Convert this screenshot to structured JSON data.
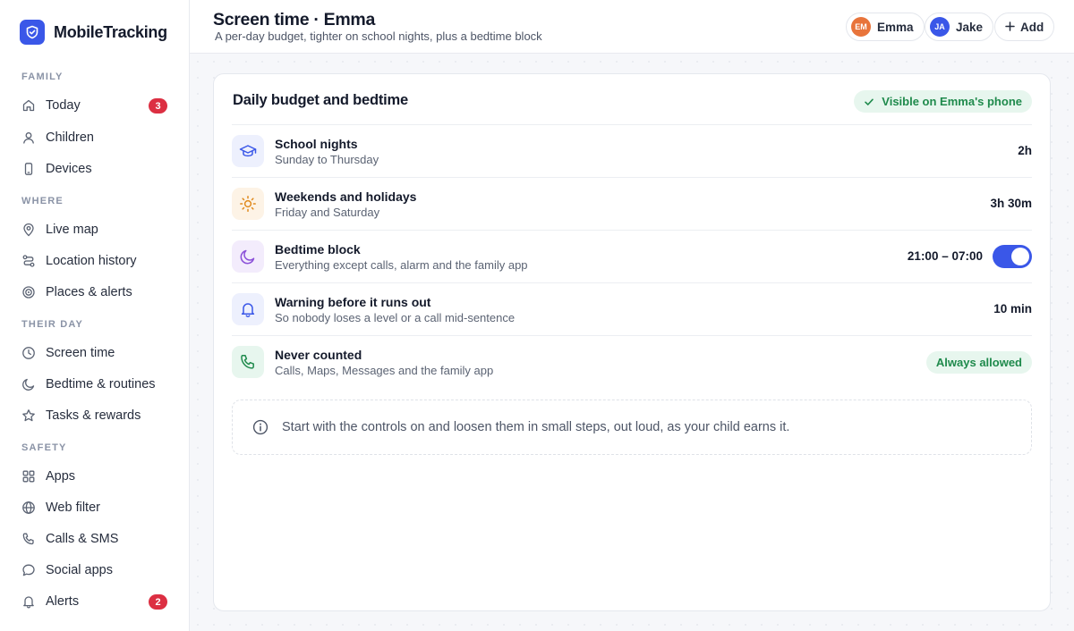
{
  "app": {
    "name": "MobileTracking"
  },
  "sidebar": {
    "sections": [
      {
        "label": "FAMILY",
        "items": [
          {
            "label": "Today",
            "icon": "home-icon",
            "badge": "3"
          },
          {
            "label": "Children",
            "icon": "person-icon"
          },
          {
            "label": "Devices",
            "icon": "phone-icon"
          }
        ]
      },
      {
        "label": "WHERE",
        "items": [
          {
            "label": "Live map",
            "icon": "pin-icon"
          },
          {
            "label": "Location history",
            "icon": "route-icon"
          },
          {
            "label": "Places & alerts",
            "icon": "target-icon"
          }
        ]
      },
      {
        "label": "THEIR DAY",
        "items": [
          {
            "label": "Screen time",
            "icon": "clock-icon"
          },
          {
            "label": "Bedtime & routines",
            "icon": "moon-icon"
          },
          {
            "label": "Tasks & rewards",
            "icon": "star-icon"
          }
        ]
      },
      {
        "label": "SAFETY",
        "items": [
          {
            "label": "Apps",
            "icon": "grid-icon"
          },
          {
            "label": "Web filter",
            "icon": "globe-icon"
          },
          {
            "label": "Calls & SMS",
            "icon": "phone-call-icon"
          },
          {
            "label": "Social apps",
            "icon": "chat-icon"
          },
          {
            "label": "Alerts",
            "icon": "bell-icon",
            "badge": "2"
          }
        ]
      }
    ]
  },
  "header": {
    "title": "Screen time · Emma",
    "subtitle": "A per-day budget, tighter on school nights, plus a bedtime block",
    "children": [
      {
        "initials": "EM",
        "name": "Emma",
        "color": "#e8743b"
      },
      {
        "initials": "JA",
        "name": "Jake",
        "color": "#3a57e8"
      }
    ],
    "add_label": "Add"
  },
  "card": {
    "title": "Daily budget and bedtime",
    "visibility": "Visible on Emma's phone",
    "rows": [
      {
        "title": "School nights",
        "subtitle": "Sunday to Thursday",
        "value": "2h",
        "icon": "graduation-cap-icon",
        "color": "#3a57e8"
      },
      {
        "title": "Weekends and holidays",
        "subtitle": "Friday and Saturday",
        "value": "3h 30m",
        "icon": "sun-icon",
        "color": "#e08a1e"
      },
      {
        "title": "Bedtime block",
        "subtitle": "Everything except calls, alarm and the family app",
        "value": "21:00 – 07:00",
        "icon": "moon-icon",
        "color": "#8a4fd8",
        "toggle_on": true
      },
      {
        "title": "Warning before it runs out",
        "subtitle": "So nobody loses a level or a call mid-sentence",
        "value": "10 min",
        "icon": "bell-icon",
        "color": "#3a57e8"
      },
      {
        "title": "Never counted",
        "subtitle": "Calls, Maps, Messages and the family app",
        "value": "Always allowed",
        "icon": "phone-call-icon",
        "color": "#1f8a4c"
      }
    ],
    "tip": "Start with the controls on and loosen them in small steps, out loud, as your child earns it."
  },
  "colors": {
    "accent": "#3a57e8",
    "success": "#1f8a4c",
    "badge": "#dc2f42"
  }
}
